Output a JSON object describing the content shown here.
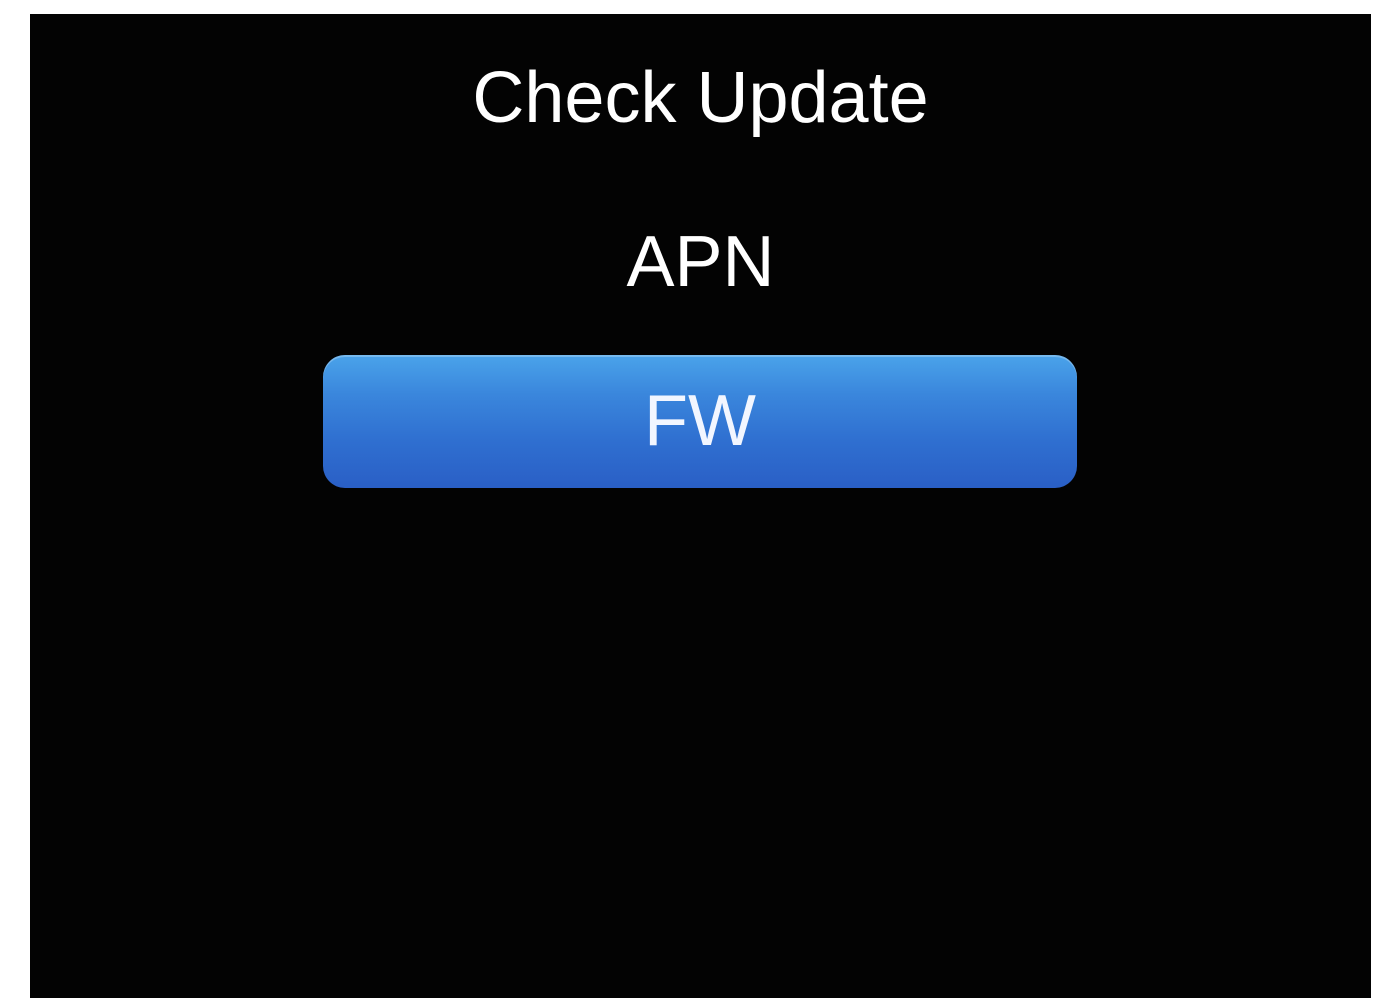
{
  "screen": {
    "title": "Check Update",
    "menu_items": [
      {
        "label": "APN",
        "selected": false
      },
      {
        "label": "FW",
        "selected": true
      }
    ]
  },
  "colors": {
    "background": "#030303",
    "text": "#ffffff",
    "selected_highlight": "#2f6fd0"
  }
}
